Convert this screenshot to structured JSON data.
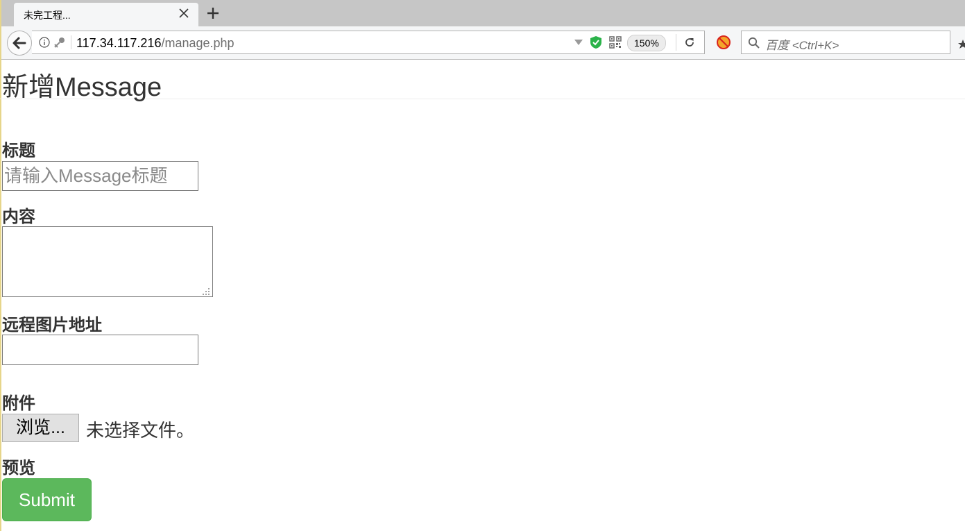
{
  "browser": {
    "tab_title": "未完工程...",
    "url_host": "117.34.117.216",
    "url_path": "/manage.php",
    "zoom_level": "150%",
    "search_placeholder": "百度 <Ctrl+K>"
  },
  "page": {
    "title": "新增Message"
  },
  "form": {
    "title_label": "标题",
    "title_placeholder": "请输入Message标题",
    "title_value": "",
    "content_label": "内容",
    "content_value": "",
    "image_url_label": "远程图片地址",
    "image_url_value": "",
    "attachment_label": "附件",
    "browse_button": "浏览...",
    "file_status": "未选择文件。",
    "preview_label": "预览",
    "submit_button": "Submit"
  },
  "colors": {
    "submit_bg": "#5cb85c",
    "text": "#333333",
    "tabbar_bg": "#c6c6c6"
  }
}
